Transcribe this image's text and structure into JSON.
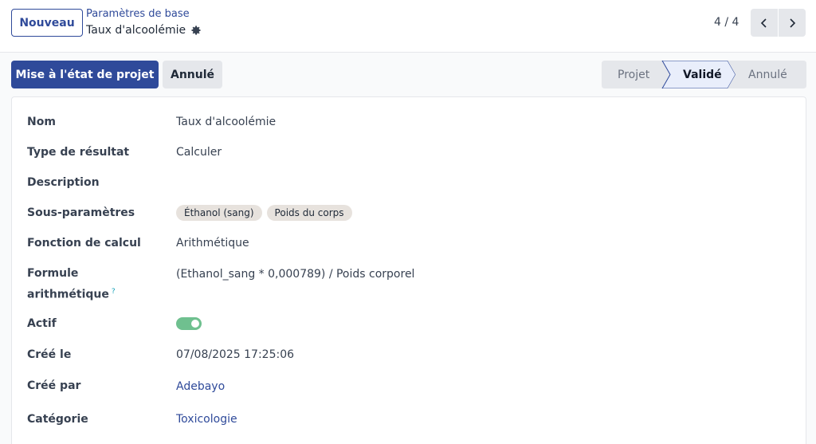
{
  "control_panel": {
    "new_button": "Nouveau",
    "breadcrumb_parent": "Paramètres de base",
    "breadcrumb_current": "Taux d'alcoolémie",
    "pager_value": "4 / 4"
  },
  "statusbar": {
    "primary_action": "Mise à l'état de projet",
    "secondary_action": "Annulé",
    "stages": [
      "Projet",
      "Validé",
      "Annulé"
    ],
    "active_stage": "Validé"
  },
  "form": {
    "name_label": "Nom",
    "name_value": "Taux d'alcoolémie",
    "result_type_label": "Type de résultat",
    "result_type_value": "Calculer",
    "description_label": "Description",
    "subparams_label": "Sous-paramètres",
    "subparams_tags": [
      "Éthanol (sang)",
      "Poids du corps"
    ],
    "calc_function_label": "Fonction de calcul",
    "calc_function_value": "Arithmétique",
    "formula_label_line1": "Formule",
    "formula_label_line2": "arithmétique",
    "formula_help_mark": "?",
    "formula_value": "(Ethanol_sang * 0,000789) / Poids corporel",
    "active_label": "Actif",
    "active_value": true,
    "created_on_label": "Créé le",
    "created_on_value": "07/08/2025 17:25:06",
    "created_by_label": "Créé par",
    "created_by_value": "Adebayo",
    "category_label": "Catégorie",
    "category_value": "Toxicologie"
  },
  "colors": {
    "primary": "#2f4a9a",
    "toggle_on": "#6fc08f",
    "tag_bg": "#e7e2dd",
    "help_mark": "#17a2b8"
  },
  "icons": {
    "settings": "gear-icon",
    "previous": "chevron-left-icon",
    "next": "chevron-right-icon"
  }
}
